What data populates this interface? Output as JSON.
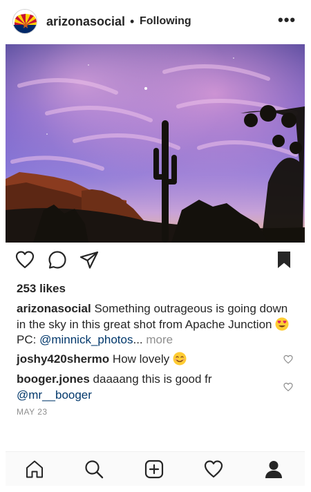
{
  "header": {
    "username": "arizonasocial",
    "separator": "•",
    "follow_status": "Following",
    "more_label": "•••"
  },
  "post": {
    "likes": "253 likes",
    "caption": {
      "username": "arizonasocial",
      "text_before_emoji": "Something outrageous is going down in the sky in this great shot from Apache Junction",
      "text_after_emoji": "PC:",
      "mention": "@minnick_photos",
      "ellipsis": "...",
      "more": "more"
    },
    "comments": [
      {
        "username": "joshy420shermo",
        "text": "How lovely"
      },
      {
        "username": "booger.jones",
        "text": "daaaang this is good fr",
        "mention": "@mr__booger"
      }
    ],
    "date": "MAY 23"
  },
  "colors": {
    "text": "#262626",
    "link": "#00376b",
    "muted": "#8e8e8e",
    "tabbar_bg": "#fafafa"
  },
  "icons": {
    "like": "heart-outline-icon",
    "comment": "speech-bubble-icon",
    "share": "paper-plane-icon",
    "save": "bookmark-filled-icon",
    "home": "home-icon",
    "search": "search-icon",
    "new_post": "plus-square-icon",
    "activity": "heart-outline-icon",
    "profile": "person-filled-icon"
  }
}
